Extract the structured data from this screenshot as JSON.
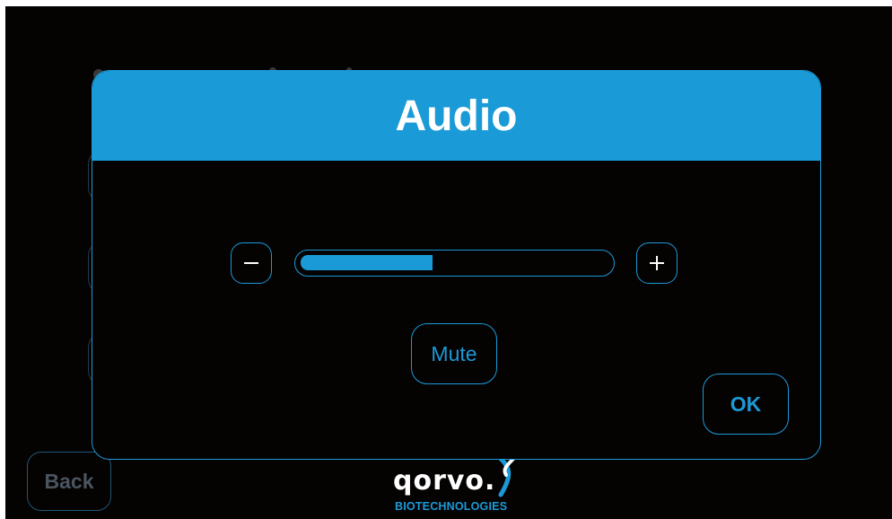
{
  "dialog": {
    "title": "Audio",
    "volume": {
      "level_percent": 43,
      "decrease_label": "−",
      "increase_label": "+"
    },
    "mute_label": "Mute",
    "ok_label": "OK"
  },
  "footer": {
    "back_label": "Back",
    "logo_word": "qorvo.",
    "logo_sub": "BIOTECHNOLOGIES"
  },
  "colors": {
    "accent": "#1a9ad7",
    "background": "#050202",
    "header_text": "#ffffff",
    "disabled_text": "#4a5560"
  },
  "icons": [
    "minus-icon",
    "plus-icon",
    "qorvo-helix-icon"
  ]
}
